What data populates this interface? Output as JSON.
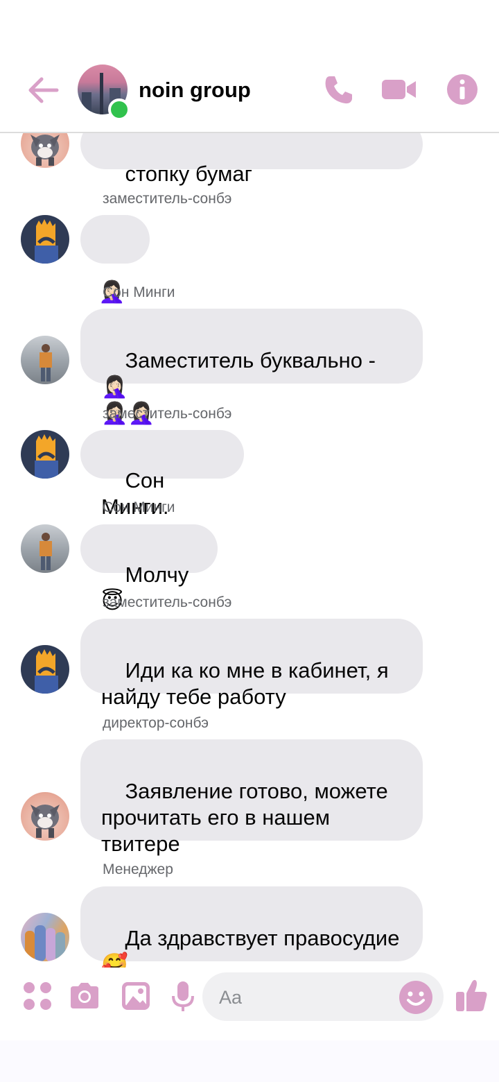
{
  "header": {
    "title": "noin group",
    "accent_color": "#d9a0c8",
    "online_color": "#31c24d",
    "icons": [
      "back-arrow-icon",
      "phone-icon",
      "video-camera-icon",
      "info-icon"
    ]
  },
  "messages": [
    {
      "sender": "",
      "text": "стопку бумаг",
      "avatar": "tom-cat"
    },
    {
      "sender": "заместитель-сонбэ",
      "text": "🤦🏻‍♀️",
      "avatar": "bart"
    },
    {
      "sender": "Сон Минги",
      "text": "Заместитель буквально - 🤦🏻‍♀️\n🤦🏻‍♀️🤦🏻‍♀️",
      "avatar": "photo"
    },
    {
      "sender": "заместитель-сонбэ",
      "text": "Сон Минги.",
      "avatar": "bart"
    },
    {
      "sender": "Сон Минги",
      "text": "Молчу😇",
      "avatar": "photo"
    },
    {
      "sender": "заместитель-сонбэ",
      "text": "Иди ка ко мне в кабинет, я\nнайду тебе работу",
      "avatar": "bart"
    },
    {
      "sender": "директор-сонбэ",
      "text": "Заявление готово, можете\nпрочитать его в нашем\nтвитере",
      "avatar": "tom-cat"
    },
    {
      "sender": "Менеджер",
      "text": "Да здравствует правосудие\n🥰",
      "avatar": "crowd"
    }
  ],
  "composer": {
    "placeholder": "Aa",
    "icons": [
      "apps-icon",
      "camera-icon",
      "gallery-icon",
      "microphone-icon",
      "emoji-icon",
      "thumbs-up-icon"
    ]
  },
  "colors": {
    "bubble": "#e9e8ec",
    "sender_text": "#65676b",
    "icon_pink": "#d9a0c8"
  }
}
